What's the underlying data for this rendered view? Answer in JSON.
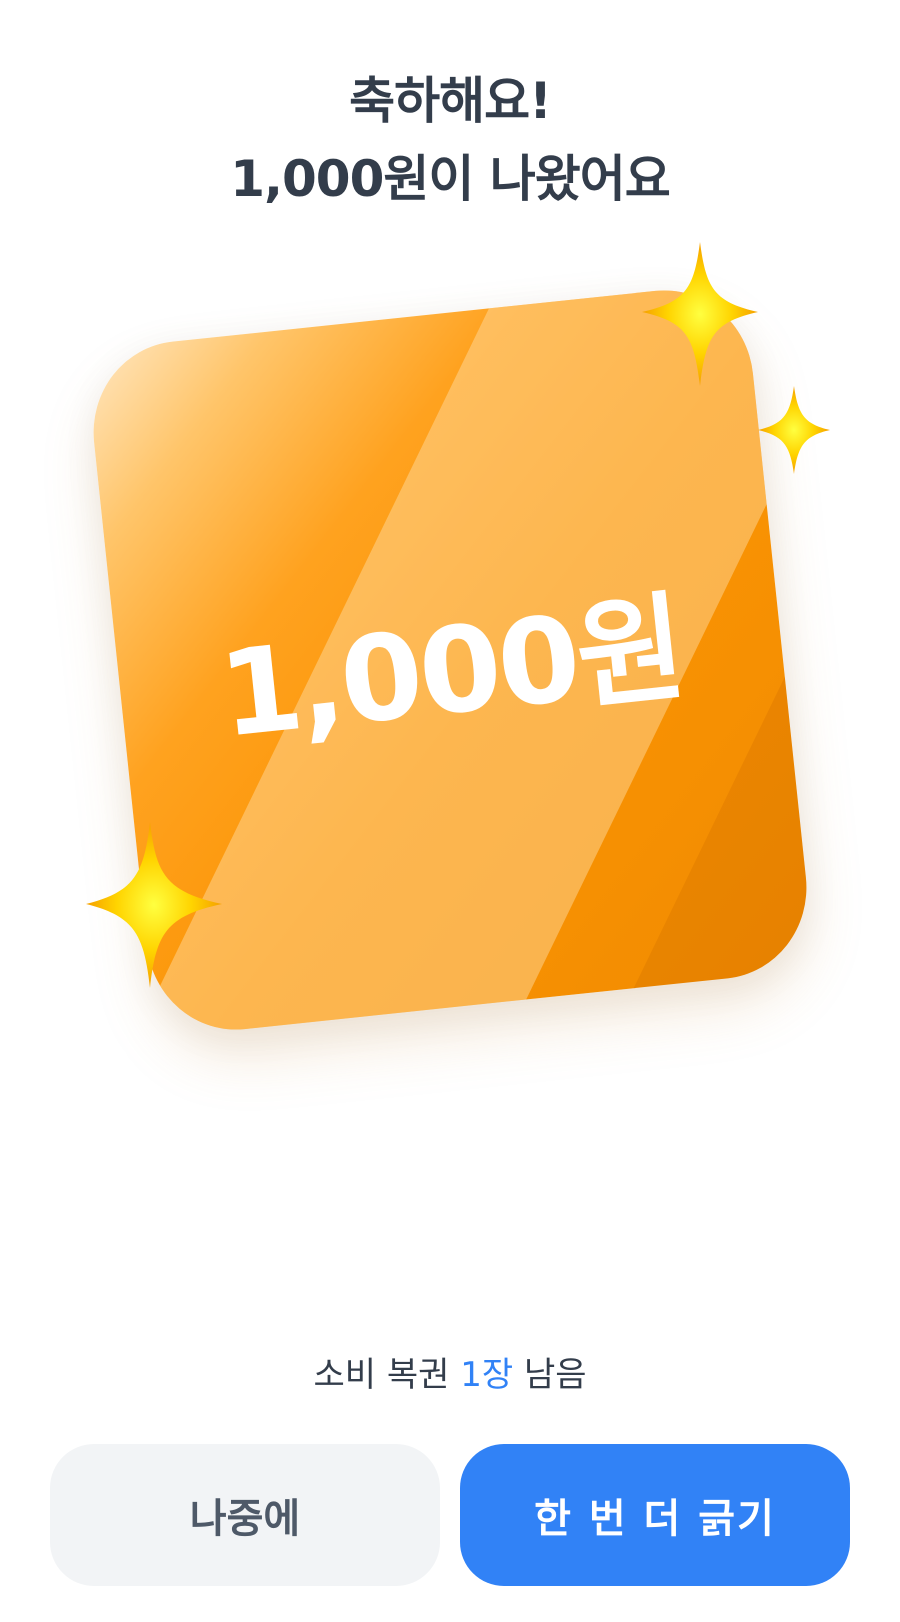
{
  "header": {
    "title_line1": "축하해요!",
    "title_line2": "1,000원이 나왔어요"
  },
  "card": {
    "amount": "1,000원",
    "colors": {
      "card_main": "#fb9404",
      "card_highlight": "#ffe7c2",
      "sparkle": "#ffd400"
    }
  },
  "remaining": {
    "prefix": "소비 복권",
    "count": "1장",
    "suffix": "남음",
    "count_color": "#3182f6"
  },
  "buttons": {
    "later_label": "나중에",
    "again_label": "한 번 더 긁기",
    "primary_color": "#3182f6",
    "secondary_color": "#f2f4f6"
  }
}
